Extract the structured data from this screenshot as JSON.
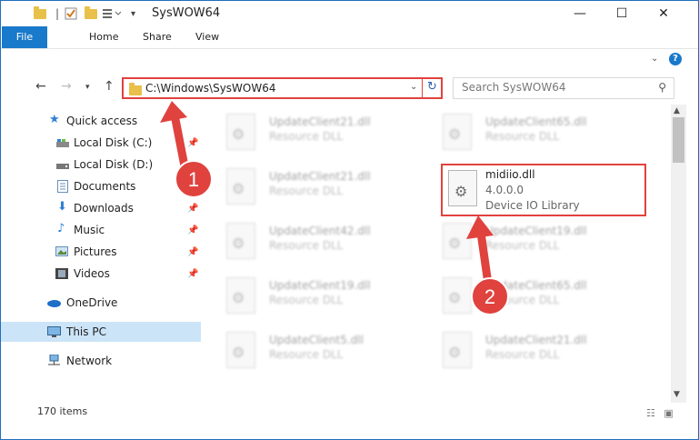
{
  "window": {
    "title": "SysWOW64",
    "minimize": "—",
    "maximize": "☐",
    "close": "✕"
  },
  "ribbon": {
    "file": "File",
    "home": "Home",
    "share": "Share",
    "view": "View",
    "help": "?"
  },
  "address": {
    "path": "C:\\Windows\\SysWOW64",
    "search_placeholder": "Search SysWOW64"
  },
  "sidebar": {
    "items": [
      {
        "label": "Quick access",
        "icon": "star-icon"
      },
      {
        "label": "Local Disk (C:)",
        "icon": "drive-icon",
        "pinned": true
      },
      {
        "label": "Local Disk (D:)",
        "icon": "drive-icon",
        "pinned": false
      },
      {
        "label": "Documents",
        "icon": "documents-icon",
        "pinned": true
      },
      {
        "label": "Downloads",
        "icon": "downloads-icon",
        "pinned": true
      },
      {
        "label": "Music",
        "icon": "music-icon",
        "pinned": true
      },
      {
        "label": "Pictures",
        "icon": "pictures-icon",
        "pinned": true
      },
      {
        "label": "Videos",
        "icon": "videos-icon",
        "pinned": true
      },
      {
        "label": "OneDrive",
        "icon": "cloud-icon"
      },
      {
        "label": "This PC",
        "icon": "pc-icon"
      },
      {
        "label": "Network",
        "icon": "network-icon"
      }
    ]
  },
  "files": {
    "left": [
      {
        "name": "UpdateClient21.dll",
        "desc": "Resource DLL"
      },
      {
        "name": "UpdateClient21.dll",
        "desc": "Resource DLL"
      },
      {
        "name": "UpdateClient42.dll",
        "desc": "Resource DLL"
      },
      {
        "name": "UpdateClient19.dll",
        "desc": "Resource DLL"
      },
      {
        "name": "UpdateClient5.dll",
        "desc": "Resource DLL"
      }
    ],
    "right": [
      {
        "name": "UpdateClient65.dll",
        "desc": "Resource DLL"
      },
      {
        "name": "UpdateClient19.dll",
        "desc": "Resource DLL"
      },
      {
        "name": "UpdateClient65.dll",
        "desc": "Resource DLL"
      },
      {
        "name": "UpdateClient21.dll",
        "desc": "Resource DLL"
      }
    ],
    "highlighted": {
      "name": "midiio.dll",
      "version": "4.0.0.0",
      "desc": "Device IO Library"
    }
  },
  "callouts": {
    "one": "1",
    "two": "2",
    "color": "#e0423e"
  },
  "status": {
    "count": "170 items"
  }
}
